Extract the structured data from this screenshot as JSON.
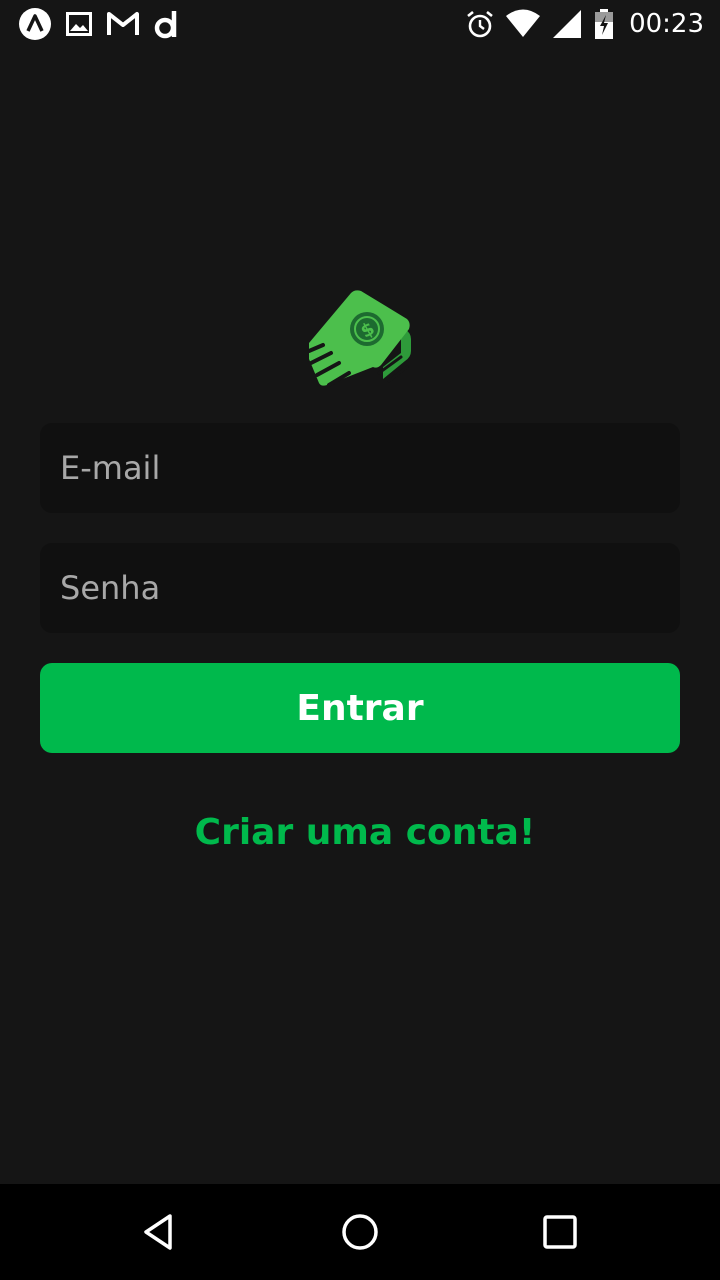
{
  "status_bar": {
    "time": "00:23",
    "left_icons": [
      "arch-icon",
      "image-icon",
      "gmail-icon",
      "app-d-icon"
    ],
    "right_icons": [
      "alarm-icon",
      "wifi-icon",
      "signal-icon",
      "battery-charging-icon"
    ]
  },
  "logo": {
    "icon": "flying-money-icon",
    "colors": {
      "bill": "#4cbf4c",
      "bill_dark": "#2e9a3a",
      "circle": "#1d6b30"
    }
  },
  "form": {
    "email_placeholder": "E-mail",
    "password_placeholder": "Senha",
    "login_label": "Entrar",
    "create_account_label": "Criar uma conta!"
  },
  "colors": {
    "background": "#151515",
    "input_background": "#101010",
    "accent": "#00b94c"
  },
  "nav_bar": {
    "icons": [
      "back-icon",
      "home-icon",
      "recents-icon"
    ]
  }
}
